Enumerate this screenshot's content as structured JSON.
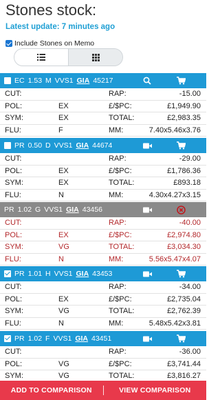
{
  "header": {
    "title": "Stones stock:",
    "update": "Latest update: 7 minutes ago",
    "memo_label": "Include Stones on Memo"
  },
  "labels": {
    "cut": "CUT:",
    "pol": "POL:",
    "sym": "SYM:",
    "flu": "FLU:",
    "rap": "RAP:",
    "ppc": "£/$PC:",
    "total": "TOTAL:",
    "mm": "MM:"
  },
  "cards": [
    {
      "shape": "EC",
      "carat": "1.53",
      "color": "M",
      "clarity": "VVS1",
      "lab": "GIA",
      "id": "45217",
      "checked": false,
      "status": "available",
      "cut": "",
      "pol": "EX",
      "sym": "EX",
      "flu": "F",
      "rap": "-15.00",
      "ppc": "£1,949.90",
      "total": "£2,983.35",
      "mm": "7.40x5.46x3.76"
    },
    {
      "shape": "PR",
      "carat": "0.50",
      "color": "D",
      "clarity": "VVS1",
      "lab": "GIA",
      "id": "44674",
      "checked": false,
      "status": "available",
      "cut": "",
      "pol": "EX",
      "sym": "EX",
      "flu": "N",
      "rap": "-29.00",
      "ppc": "£1,786.36",
      "total": "£893.18",
      "mm": "4.30x4.27x3.15"
    },
    {
      "shape": "PR",
      "carat": "1.02",
      "color": "G",
      "clarity": "VVS1",
      "lab": "GIA",
      "id": "43456",
      "checked": false,
      "status": "unavailable",
      "cut": "",
      "pol": "EX",
      "sym": "VG",
      "flu": "N",
      "rap": "-40.00",
      "ppc": "£2,974.80",
      "total": "£3,034.30",
      "mm": "5.56x5.47x4.07"
    },
    {
      "shape": "PR",
      "carat": "1.01",
      "color": "H",
      "clarity": "VVS1",
      "lab": "GIA",
      "id": "43453",
      "checked": true,
      "status": "available",
      "cut": "",
      "pol": "EX",
      "sym": "VG",
      "flu": "N",
      "rap": "-34.00",
      "ppc": "£2,735.04",
      "total": "£2,762.39",
      "mm": "5.48x5.42x3.81"
    },
    {
      "shape": "PR",
      "carat": "1.02",
      "color": "F",
      "clarity": "VVS1",
      "lab": "GIA",
      "id": "43451",
      "checked": true,
      "status": "available",
      "cut": "",
      "pol": "VG",
      "sym": "VG",
      "rap": "-36.00",
      "ppc": "£3,741.44",
      "total": "£3,816.27"
    }
  ],
  "footer": {
    "add_label": "ADD TO COMPARISON",
    "view_label": "VIEW COMPARISON"
  },
  "colors": {
    "header_blue": "#1e9ad6",
    "header_gray": "#8a8a8a",
    "unavailable_text": "#b3282b",
    "footer_red": "#e8394b",
    "update_text": "#1f9fd4"
  }
}
